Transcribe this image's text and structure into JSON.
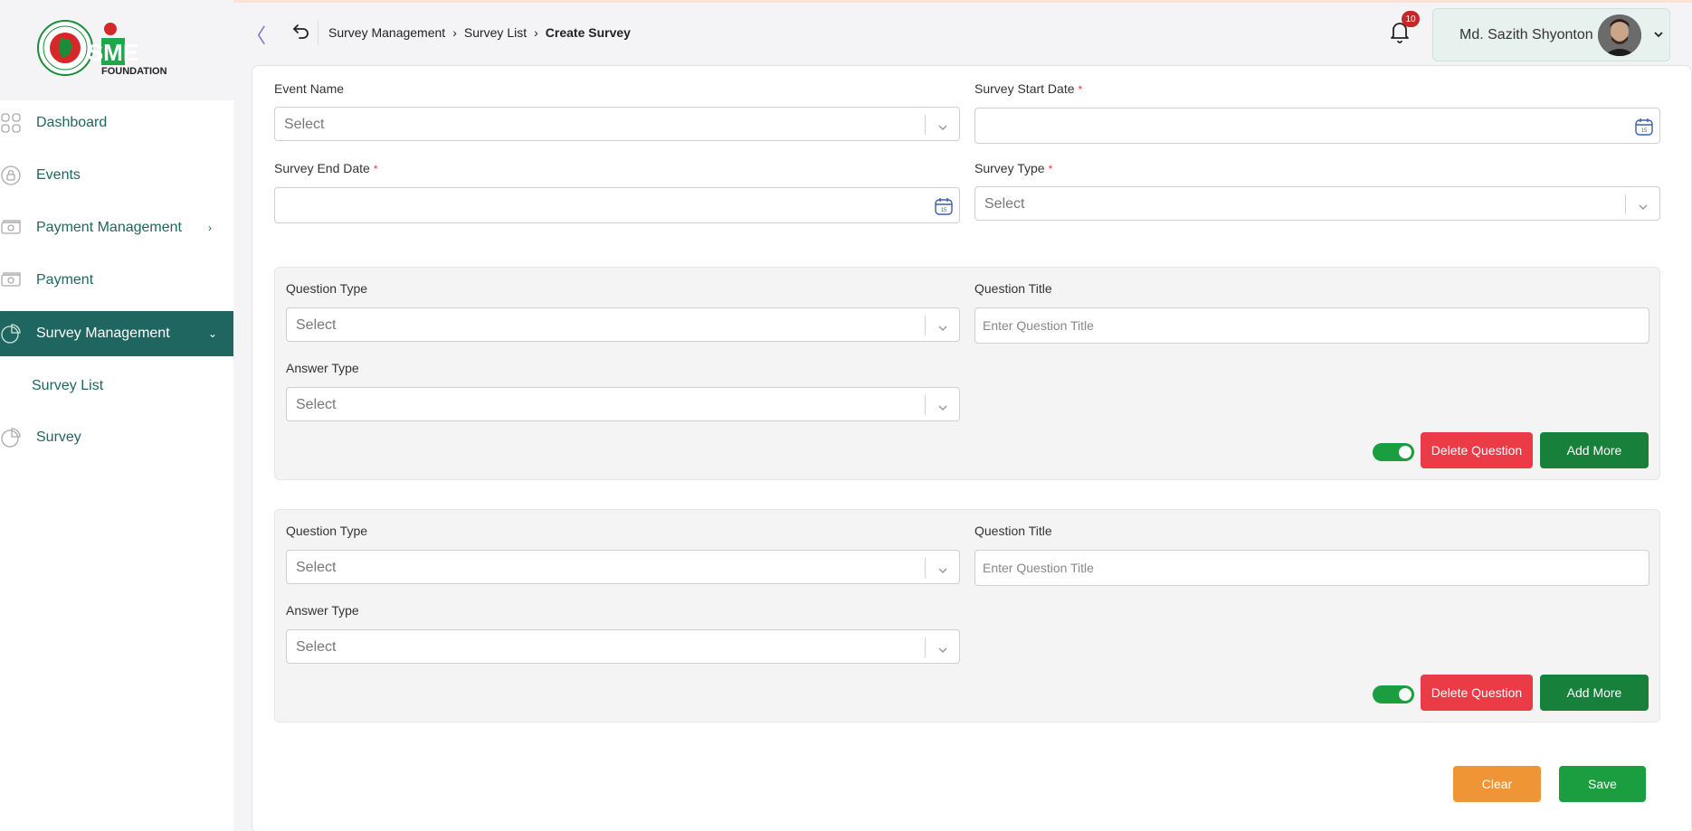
{
  "logo": {
    "text": "SME",
    "sub": "FOUNDATION"
  },
  "sidebar": {
    "items": [
      {
        "label": "Dashboard",
        "icon": "grid-icon"
      },
      {
        "label": "Events",
        "icon": "lock-icon"
      },
      {
        "label": "Payment Management",
        "icon": "cash-icon",
        "arrow": "›"
      },
      {
        "label": "Payment",
        "icon": "cash-icon"
      },
      {
        "label": "Survey Management",
        "icon": "pie-chart-icon",
        "arrow": "⌄",
        "active": true
      },
      {
        "label": "Survey",
        "icon": "pie-chart-icon"
      }
    ],
    "sub_items": [
      {
        "label": "Survey List"
      }
    ]
  },
  "header": {
    "collapse_glyph": "〈",
    "breadcrumb": [
      "Survey Management",
      "Survey List",
      "Create Survey"
    ],
    "notifications": "10",
    "user_name": "Md. Sazith Shyonton"
  },
  "form": {
    "event_name_label": "Event Name",
    "event_name_placeholder": "Select",
    "start_date_label": "Survey Start Date",
    "end_date_label": "Survey End Date",
    "survey_type_label": "Survey Type",
    "survey_type_placeholder": "Select",
    "required_mark": "*"
  },
  "questions": [
    {
      "question_type_label": "Question Type",
      "question_type_placeholder": "Select",
      "question_title_label": "Question Title",
      "question_title_placeholder": "Enter Question Title",
      "answer_type_label": "Answer Type",
      "answer_type_placeholder": "Select",
      "delete_label": "Delete Question",
      "add_label": "Add More"
    },
    {
      "question_type_label": "Question Type",
      "question_type_placeholder": "Select",
      "question_title_label": "Question Title",
      "question_title_placeholder": "Enter Question Title",
      "answer_type_label": "Answer Type",
      "answer_type_placeholder": "Select",
      "delete_label": "Delete Question",
      "add_label": "Add More"
    }
  ],
  "actions": {
    "clear_label": "Clear",
    "save_label": "Save"
  },
  "colors": {
    "brand_teal": "#1f6660",
    "delete_red": "#ea3b47",
    "add_green": "#17803a",
    "clear_orange": "#ef9536",
    "save_green": "#1a9e3f"
  }
}
